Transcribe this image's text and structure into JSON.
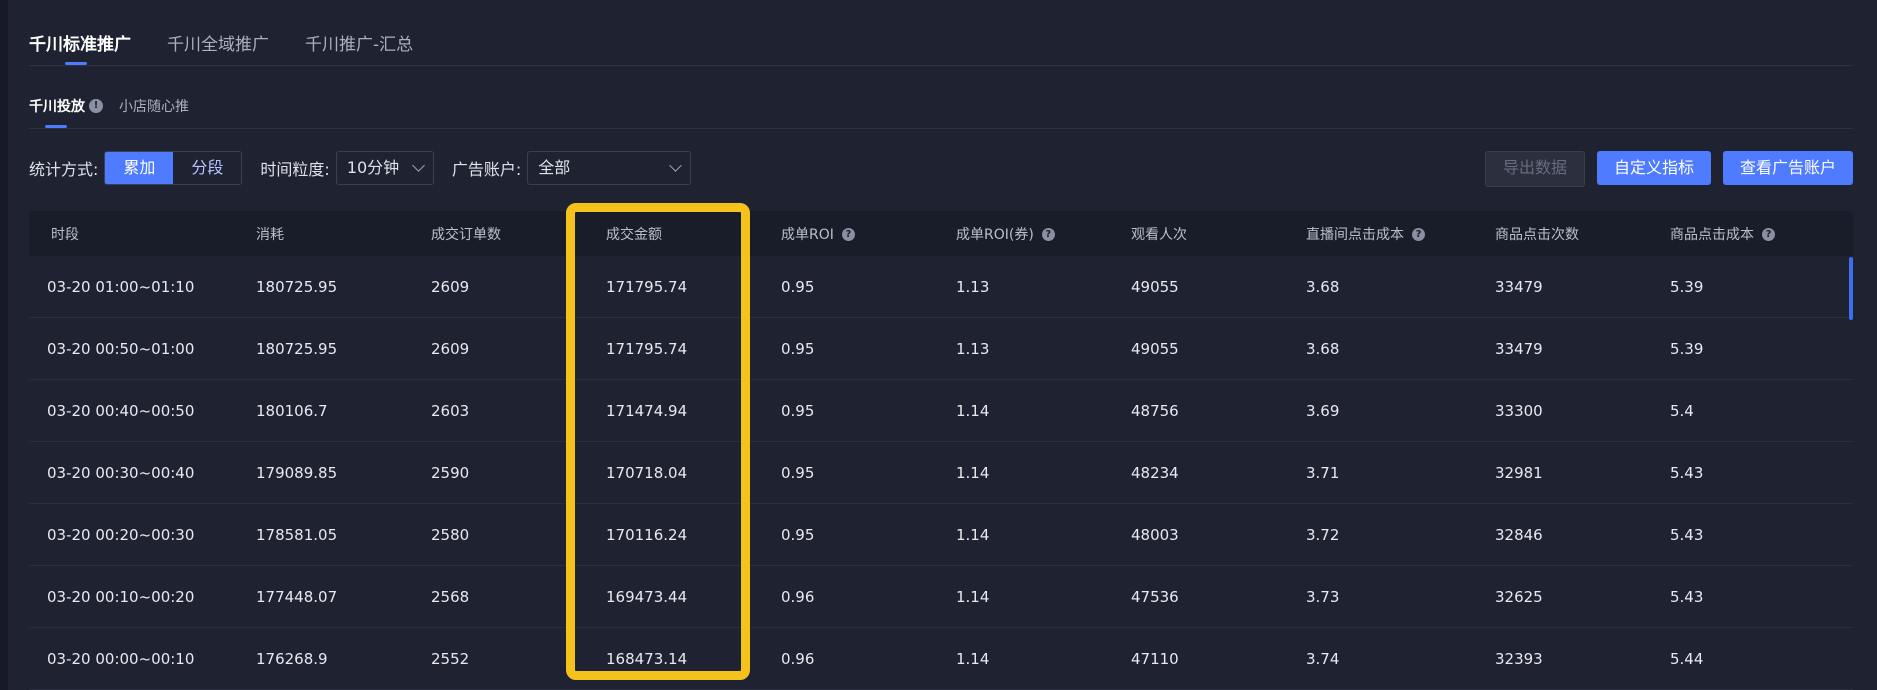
{
  "top_tabs": [
    {
      "label": "千川标准推广",
      "active": true
    },
    {
      "label": "千川全域推广",
      "active": false
    },
    {
      "label": "千川推广-汇总",
      "active": false
    }
  ],
  "sub_tabs": [
    {
      "label": "千川投放",
      "active": true
    },
    {
      "label": "小店随心推",
      "active": false
    }
  ],
  "filters": {
    "stat_label": "统计方式:",
    "stat_options": [
      "累加",
      "分段"
    ],
    "granularity_label": "时间粒度:",
    "granularity_value": "10分钟",
    "account_label": "广告账户:",
    "account_value": "全部"
  },
  "buttons": {
    "export": "导出数据",
    "custom_metrics": "自定义指标",
    "view_accounts": "查看广告账户"
  },
  "table": {
    "columns": [
      "时段",
      "消耗",
      "成交订单数",
      "成交金额",
      "成单ROI",
      "成单ROI(券)",
      "观看人次",
      "直播间点击成本",
      "商品点击次数",
      "商品点击成本"
    ],
    "rows": [
      [
        "03-20  01:00~01:10",
        "180725.95",
        "2609",
        "171795.74",
        "0.95",
        "1.13",
        "49055",
        "3.68",
        "33479",
        "5.39"
      ],
      [
        "03-20  00:50~01:00",
        "180725.95",
        "2609",
        "171795.74",
        "0.95",
        "1.13",
        "49055",
        "3.68",
        "33479",
        "5.39"
      ],
      [
        "03-20  00:40~00:50",
        "180106.7",
        "2603",
        "171474.94",
        "0.95",
        "1.14",
        "48756",
        "3.69",
        "33300",
        "5.4"
      ],
      [
        "03-20  00:30~00:40",
        "179089.85",
        "2590",
        "170718.04",
        "0.95",
        "1.14",
        "48234",
        "3.71",
        "32981",
        "5.43"
      ],
      [
        "03-20  00:20~00:30",
        "178581.05",
        "2580",
        "170116.24",
        "0.95",
        "1.14",
        "48003",
        "3.72",
        "32846",
        "5.43"
      ],
      [
        "03-20  00:10~00:20",
        "177448.07",
        "2568",
        "169473.44",
        "0.96",
        "1.14",
        "47536",
        "3.73",
        "32625",
        "5.43"
      ],
      [
        "03-20  00:00~00:10",
        "176268.9",
        "2552",
        "168473.14",
        "0.96",
        "1.14",
        "47110",
        "3.74",
        "32393",
        "5.44"
      ]
    ]
  },
  "colors": {
    "accent": "#4e7bff",
    "highlight": "#f5c21b",
    "background": "#1e2231"
  }
}
